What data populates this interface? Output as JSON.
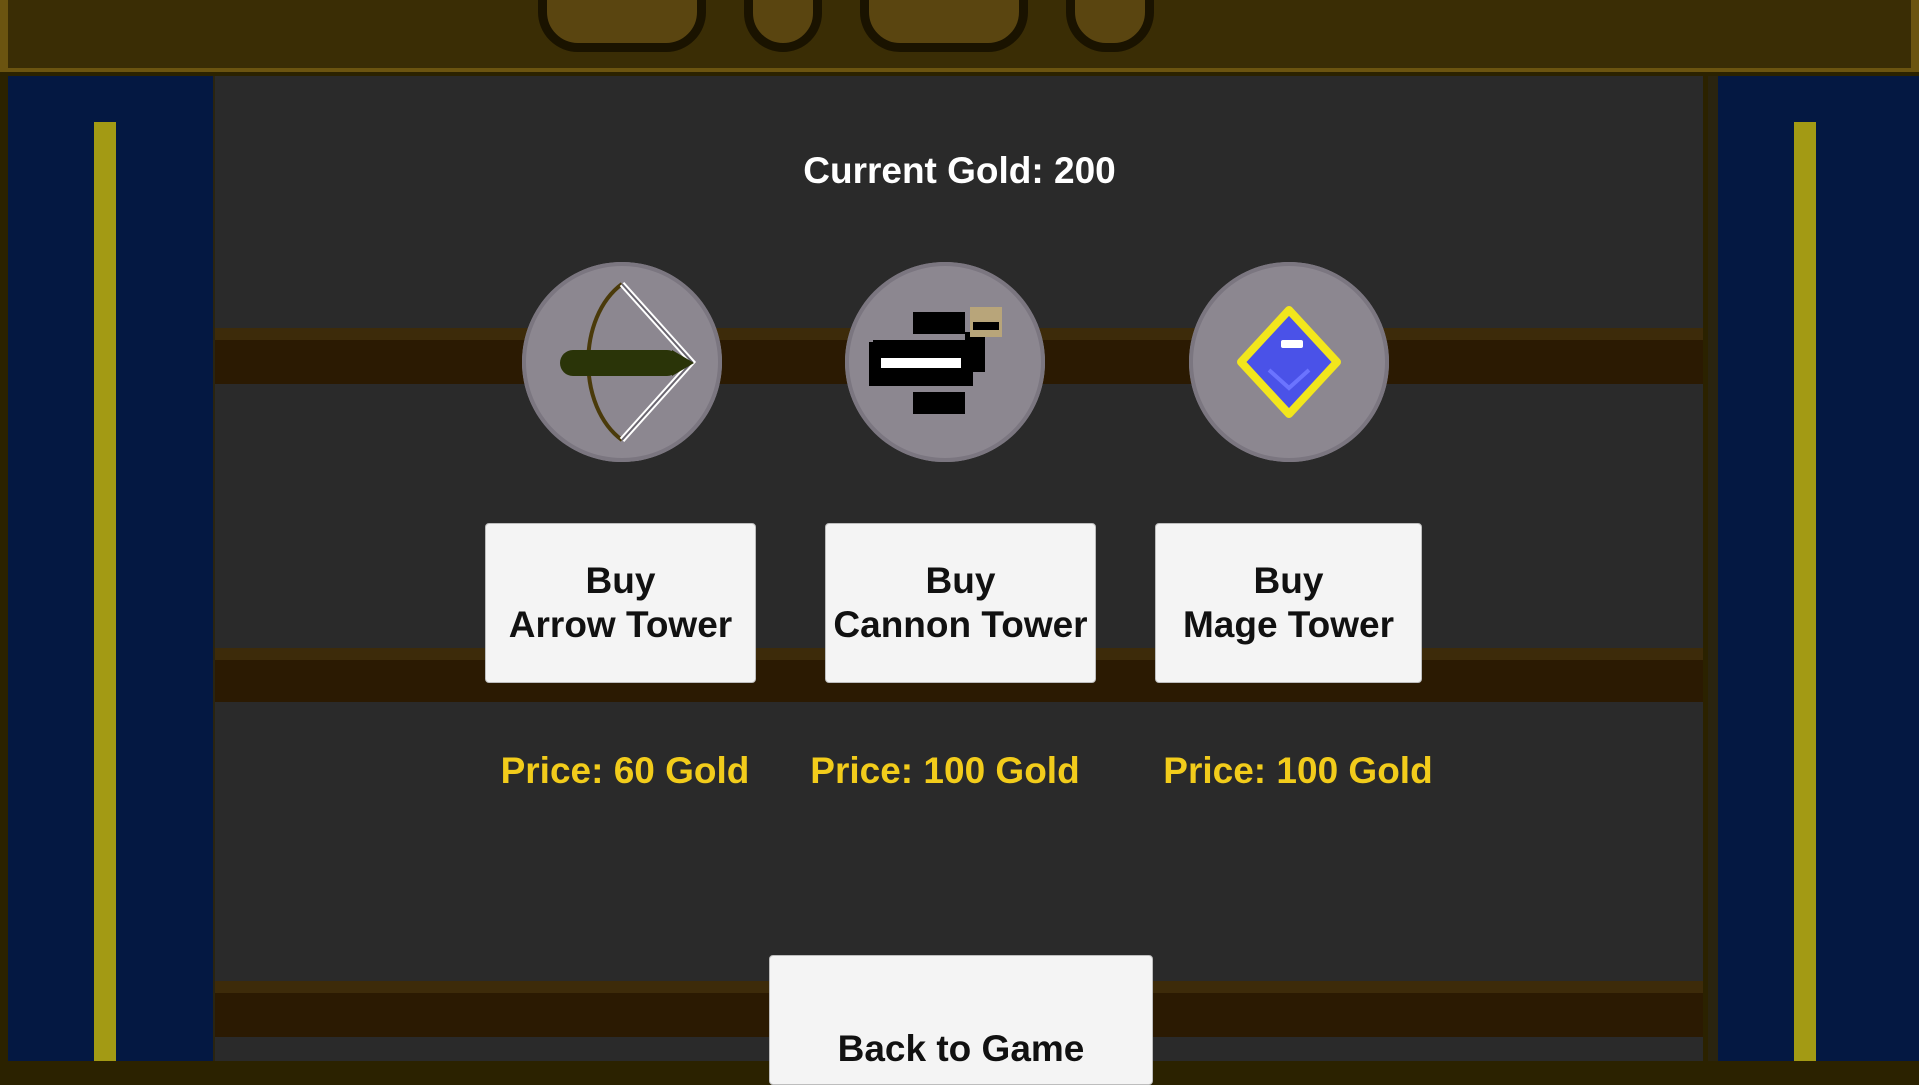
{
  "gold": {
    "label": "Current Gold: 200",
    "amount": 200
  },
  "towers": [
    {
      "name": "Arrow Tower",
      "icon": "bow-arrow-icon",
      "buy_label": "Buy\nArrow Tower",
      "price_label": "Price: 60 Gold",
      "price": 60
    },
    {
      "name": "Cannon Tower",
      "icon": "cannon-icon",
      "buy_label": "Buy\nCannon Tower",
      "price_label": "Price: 100 Gold",
      "price": 100
    },
    {
      "name": "Mage Tower",
      "icon": "blue-gem-icon",
      "buy_label": "Buy\nMage Tower",
      "price_label": "Price: 100 Gold",
      "price": 100
    }
  ],
  "back_button": {
    "label": "Back to Game"
  },
  "colors": {
    "panel": "#2a2a2a",
    "side_banner": "#041842",
    "pole": "#a39a14",
    "price_text": "#f2cc1b",
    "button_bg": "#f4f4f4",
    "icon_circle": "#8c8790"
  }
}
